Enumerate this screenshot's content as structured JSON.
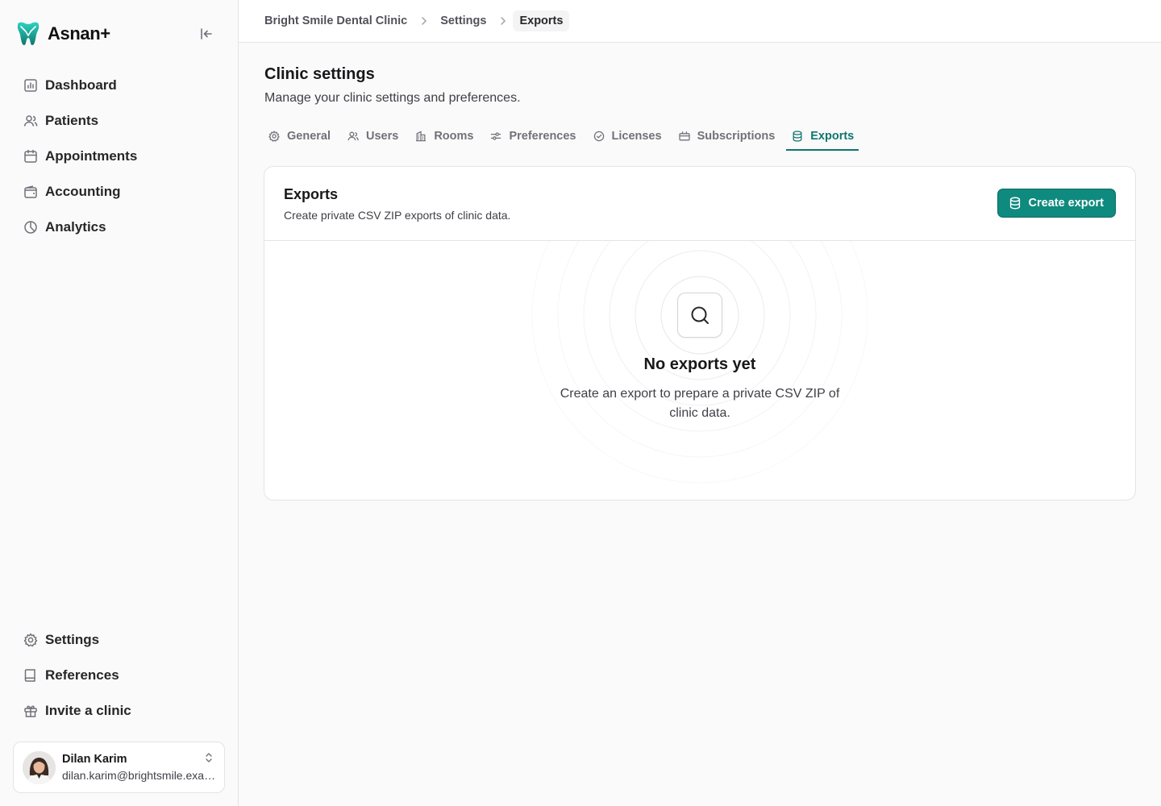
{
  "brand": {
    "name": "Asnan+"
  },
  "sidebar": {
    "top_items": [
      {
        "label": "Dashboard",
        "icon": "chart-icon"
      },
      {
        "label": "Patients",
        "icon": "users-icon"
      },
      {
        "label": "Appointments",
        "icon": "calendar-icon"
      },
      {
        "label": "Accounting",
        "icon": "wallet-icon"
      },
      {
        "label": "Analytics",
        "icon": "pie-chart-icon"
      }
    ],
    "bottom_items": [
      {
        "label": "Settings",
        "icon": "gear-icon"
      },
      {
        "label": "References",
        "icon": "book-icon"
      },
      {
        "label": "Invite a clinic",
        "icon": "gift-icon"
      }
    ],
    "user": {
      "name": "Dilan Karim",
      "email": "dilan.karim@brightsmile.example"
    }
  },
  "breadcrumb": {
    "items": [
      "Bright Smile Dental Clinic",
      "Settings"
    ],
    "current": "Exports"
  },
  "page": {
    "title": "Clinic settings",
    "subtitle": "Manage your clinic settings and preferences."
  },
  "tabs": [
    {
      "label": "General",
      "icon": "gear-icon"
    },
    {
      "label": "Users",
      "icon": "users-icon"
    },
    {
      "label": "Rooms",
      "icon": "building-icon"
    },
    {
      "label": "Preferences",
      "icon": "sliders-icon"
    },
    {
      "label": "Licenses",
      "icon": "check-circle-icon"
    },
    {
      "label": "Subscriptions",
      "icon": "ticket-icon"
    },
    {
      "label": "Exports",
      "icon": "database-icon",
      "active": true
    }
  ],
  "exports_card": {
    "title": "Exports",
    "description": "Create private CSV ZIP exports of clinic data.",
    "create_button": "Create export",
    "empty_title": "No exports yet",
    "empty_text": "Create an export to prepare a private CSV ZIP of clinic data."
  },
  "colors": {
    "accent": "#0f8a7e",
    "accent_dark": "#0f766e",
    "border": "#e4e4e7",
    "background": "#fafafa"
  }
}
